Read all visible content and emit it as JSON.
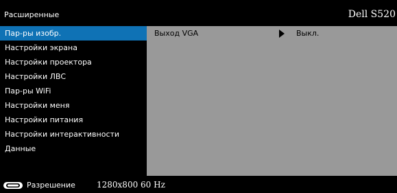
{
  "header": {
    "title": "Расширенные",
    "brand": "Dell S520"
  },
  "sidebar": {
    "items": [
      {
        "label": "Пар-ры изобр.",
        "selected": true
      },
      {
        "label": "Настройки экрана",
        "selected": false
      },
      {
        "label": "Настройки проектора",
        "selected": false
      },
      {
        "label": "Настройки ЛВС",
        "selected": false
      },
      {
        "label": "Пар-ры WiFi",
        "selected": false
      },
      {
        "label": "Настройки меня",
        "selected": false
      },
      {
        "label": "Настройки питания",
        "selected": false
      },
      {
        "label": "Настройки интерактивности",
        "selected": false
      },
      {
        "label": "Данные",
        "selected": false
      }
    ]
  },
  "content": {
    "rows": [
      {
        "label": "Выход VGA",
        "value": "Выкл."
      }
    ]
  },
  "footer": {
    "icon": "remote-control-icon",
    "resolution_label": "Разрешение",
    "resolution_value": "1280x800 60 Hz"
  },
  "colors": {
    "selected": "#0f72b5",
    "panel": "#999999",
    "background": "#000000"
  }
}
